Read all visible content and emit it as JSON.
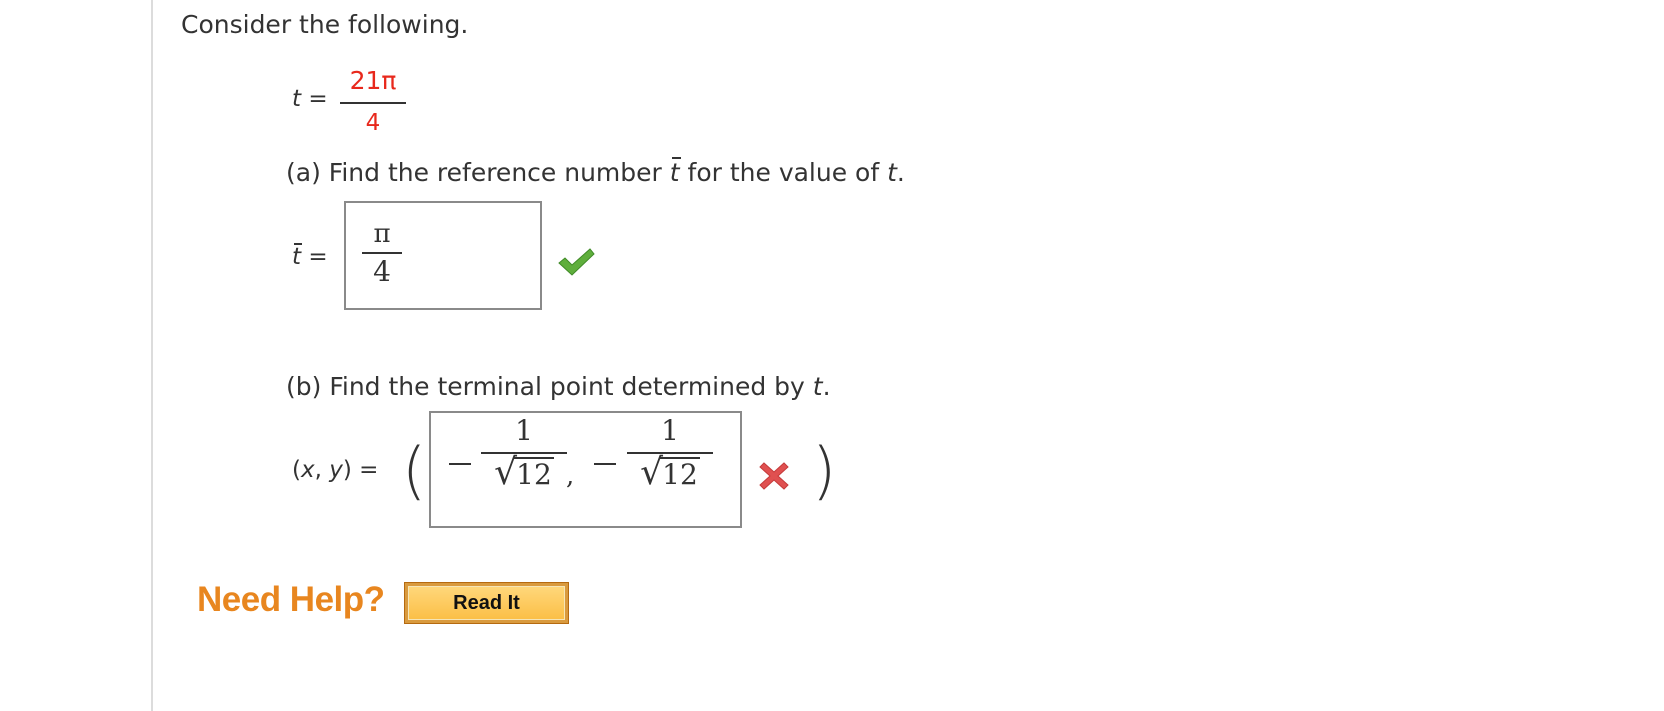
{
  "intro": "Consider the following.",
  "given": {
    "var": "t",
    "equals": "=",
    "num": "21π",
    "den": "4"
  },
  "part_a": {
    "prefix": "(a) Find the reference number ",
    "var_bar": "t",
    "middle": " for the value of ",
    "var": "t",
    "suffix": ".",
    "label_var": "t",
    "label_eq": "=",
    "answer": {
      "num": "π",
      "den": "4"
    },
    "status": "correct",
    "status_color": "#5fae3c"
  },
  "part_b": {
    "prefix": "(b) Find the terminal point determined by ",
    "var": "t",
    "suffix": ".",
    "label": "(x, y)",
    "label_x": "x",
    "label_y": "y",
    "label_eq": "=",
    "answer": {
      "x": {
        "sign": "−",
        "num": "1",
        "den": "12"
      },
      "comma": ",",
      "y": {
        "sign": "−",
        "num": "1",
        "den": "12"
      }
    },
    "status": "incorrect",
    "status_color": "#e05050"
  },
  "help": {
    "label": "Need Help?",
    "button": "Read It"
  }
}
